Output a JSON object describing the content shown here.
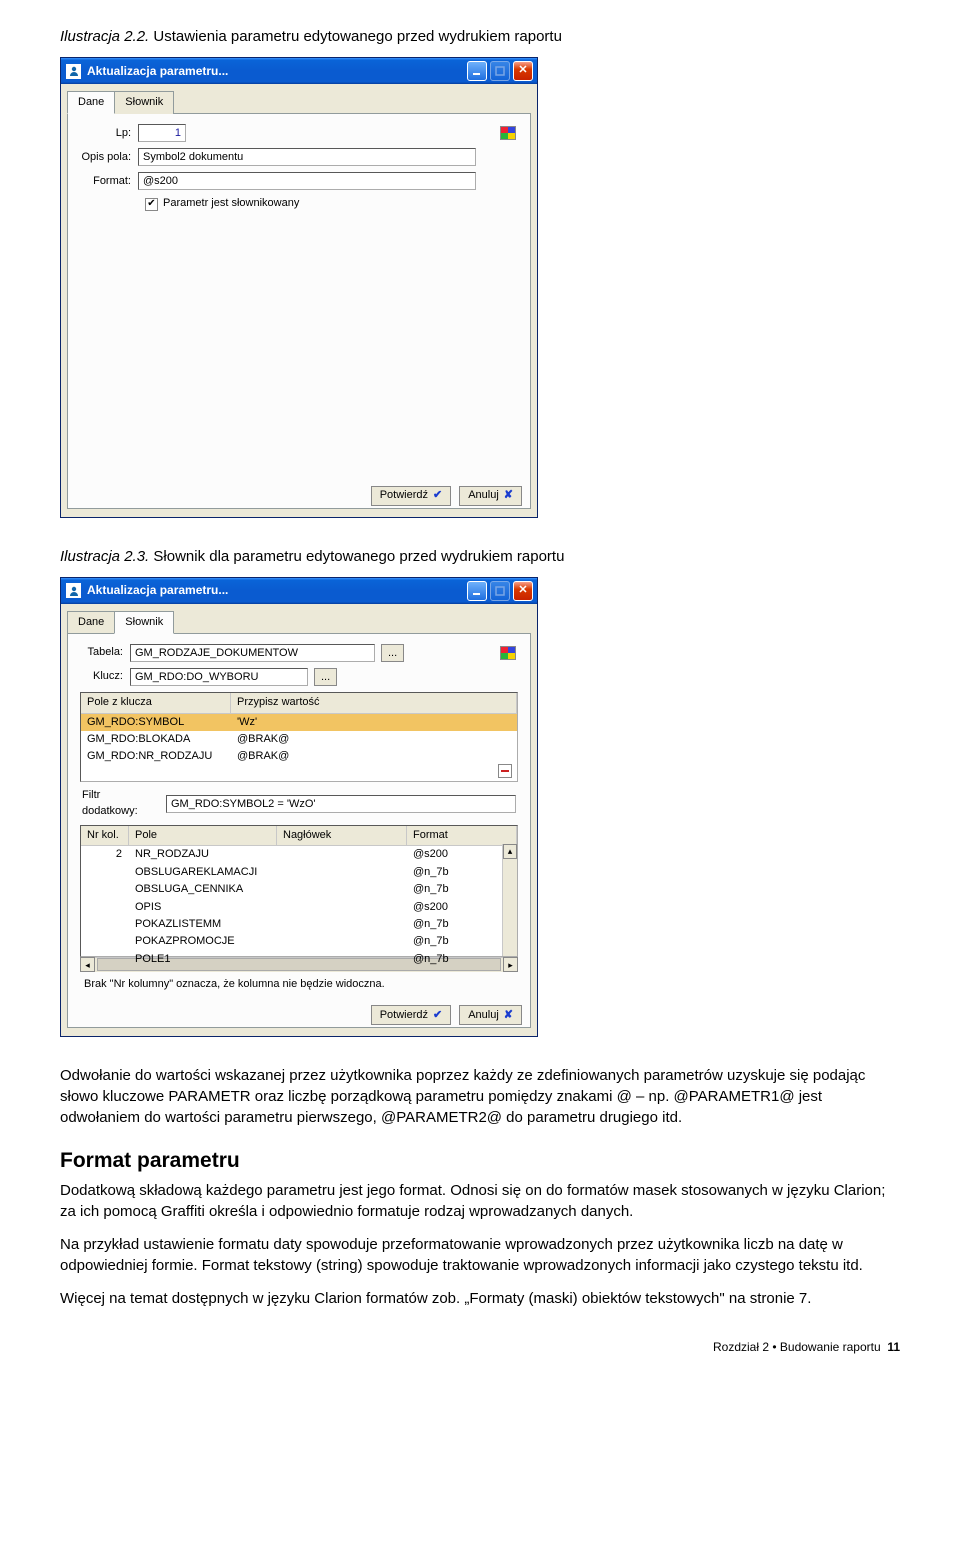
{
  "caption1_prefix": "Ilustracja 2.2.",
  "caption1_text": " Ustawienia parametru edytowanego przed wydrukiem raportu",
  "caption2_prefix": "Ilustracja 2.3.",
  "caption2_text": " Słownik dla parametru edytowanego przed wydrukiem raportu",
  "window": {
    "title": "Aktualizacja parametru...",
    "tabs": {
      "dane": "Dane",
      "slownik": "Słownik"
    },
    "confirm": "Potwierdź",
    "cancel": "Anuluj"
  },
  "form1": {
    "lp_label": "Lp:",
    "lp_value": "1",
    "opis_label": "Opis pola:",
    "opis_value": "Symbol2 dokumentu",
    "format_label": "Format:",
    "format_value": "@s200",
    "cb_label": "Parametr jest słownikowany"
  },
  "form2": {
    "tabela_label": "Tabela:",
    "tabela_value": "GM_RODZAJE_DOKUMENTOW",
    "klucz_label": "Klucz:",
    "klucz_value": "GM_RDO:DO_WYBORU",
    "browse_btn": "...",
    "list": {
      "head_a": "Pole z klucza",
      "head_b": "Przypisz wartość",
      "rows": [
        {
          "a": "GM_RDO:SYMBOL",
          "b": "'Wz'",
          "sel": true
        },
        {
          "a": "GM_RDO:BLOKADA",
          "b": "@BRAK@"
        },
        {
          "a": "GM_RDO:NR_RODZAJU",
          "b": "@BRAK@"
        }
      ]
    },
    "filter_label": "Filtr dodatkowy:",
    "filter_value": "GM_RDO:SYMBOL2 = 'WzO'",
    "grid": {
      "h_nr": "Nr kol.",
      "h_pole": "Pole",
      "h_nag": "Nagłówek",
      "h_fmt": "Format",
      "rows": [
        {
          "nr": "2",
          "pole": "NR_RODZAJU",
          "nag": "",
          "fmt": "@s200"
        },
        {
          "nr": "",
          "pole": "OBSLUGAREKLAMACJI",
          "nag": "",
          "fmt": "@n_7b"
        },
        {
          "nr": "",
          "pole": "OBSLUGA_CENNIKA",
          "nag": "",
          "fmt": "@n_7b"
        },
        {
          "nr": "",
          "pole": "OPIS",
          "nag": "",
          "fmt": "@s200"
        },
        {
          "nr": "",
          "pole": "POKAZLISTEMM",
          "nag": "",
          "fmt": "@n_7b"
        },
        {
          "nr": "",
          "pole": "POKAZPROMOCJE",
          "nag": "",
          "fmt": "@n_7b"
        },
        {
          "nr": "",
          "pole": "POLE1",
          "nag": "",
          "fmt": "@n_7b"
        }
      ]
    },
    "note": "Brak \"Nr kolumny\" oznacza, że kolumna nie będzie widoczna."
  },
  "body": {
    "p1": "Odwołanie do wartości wskazanej przez użytkownika poprzez każdy ze zdefiniowanych parametrów uzyskuje się podając słowo kluczowe PARAMETR oraz liczbę porządkową parametru pomiędzy znakami @ – np. @PARAMETR1@ jest odwołaniem do wartości parametru pierwszego, @PARAMETR2@ do parametru drugiego itd.",
    "h2": "Format parametru",
    "p2": "Dodatkową składową każdego parametru jest jego format. Odnosi się on do formatów masek stosowanych w języku Clarion; za ich pomocą Graffiti określa i odpowiednio formatuje rodzaj wprowadzanych danych.",
    "p3": "Na przykład ustawienie formatu daty spowoduje przeformatowanie wprowadzonych przez użytkownika liczb na datę w odpowiedniej formie. Format tekstowy (string) spowoduje traktowanie wprowadzonych informacji jako czystego tekstu itd.",
    "p4": "Więcej na temat dostępnych w języku Clarion formatów zob. „Formaty (maski) obiektów tekstowych\" na stronie 7.",
    "footer_ch": "Rozdział 2 ",
    "footer_sep": "• ",
    "footer_title": "Budowanie raportu",
    "footer_page": "11"
  }
}
